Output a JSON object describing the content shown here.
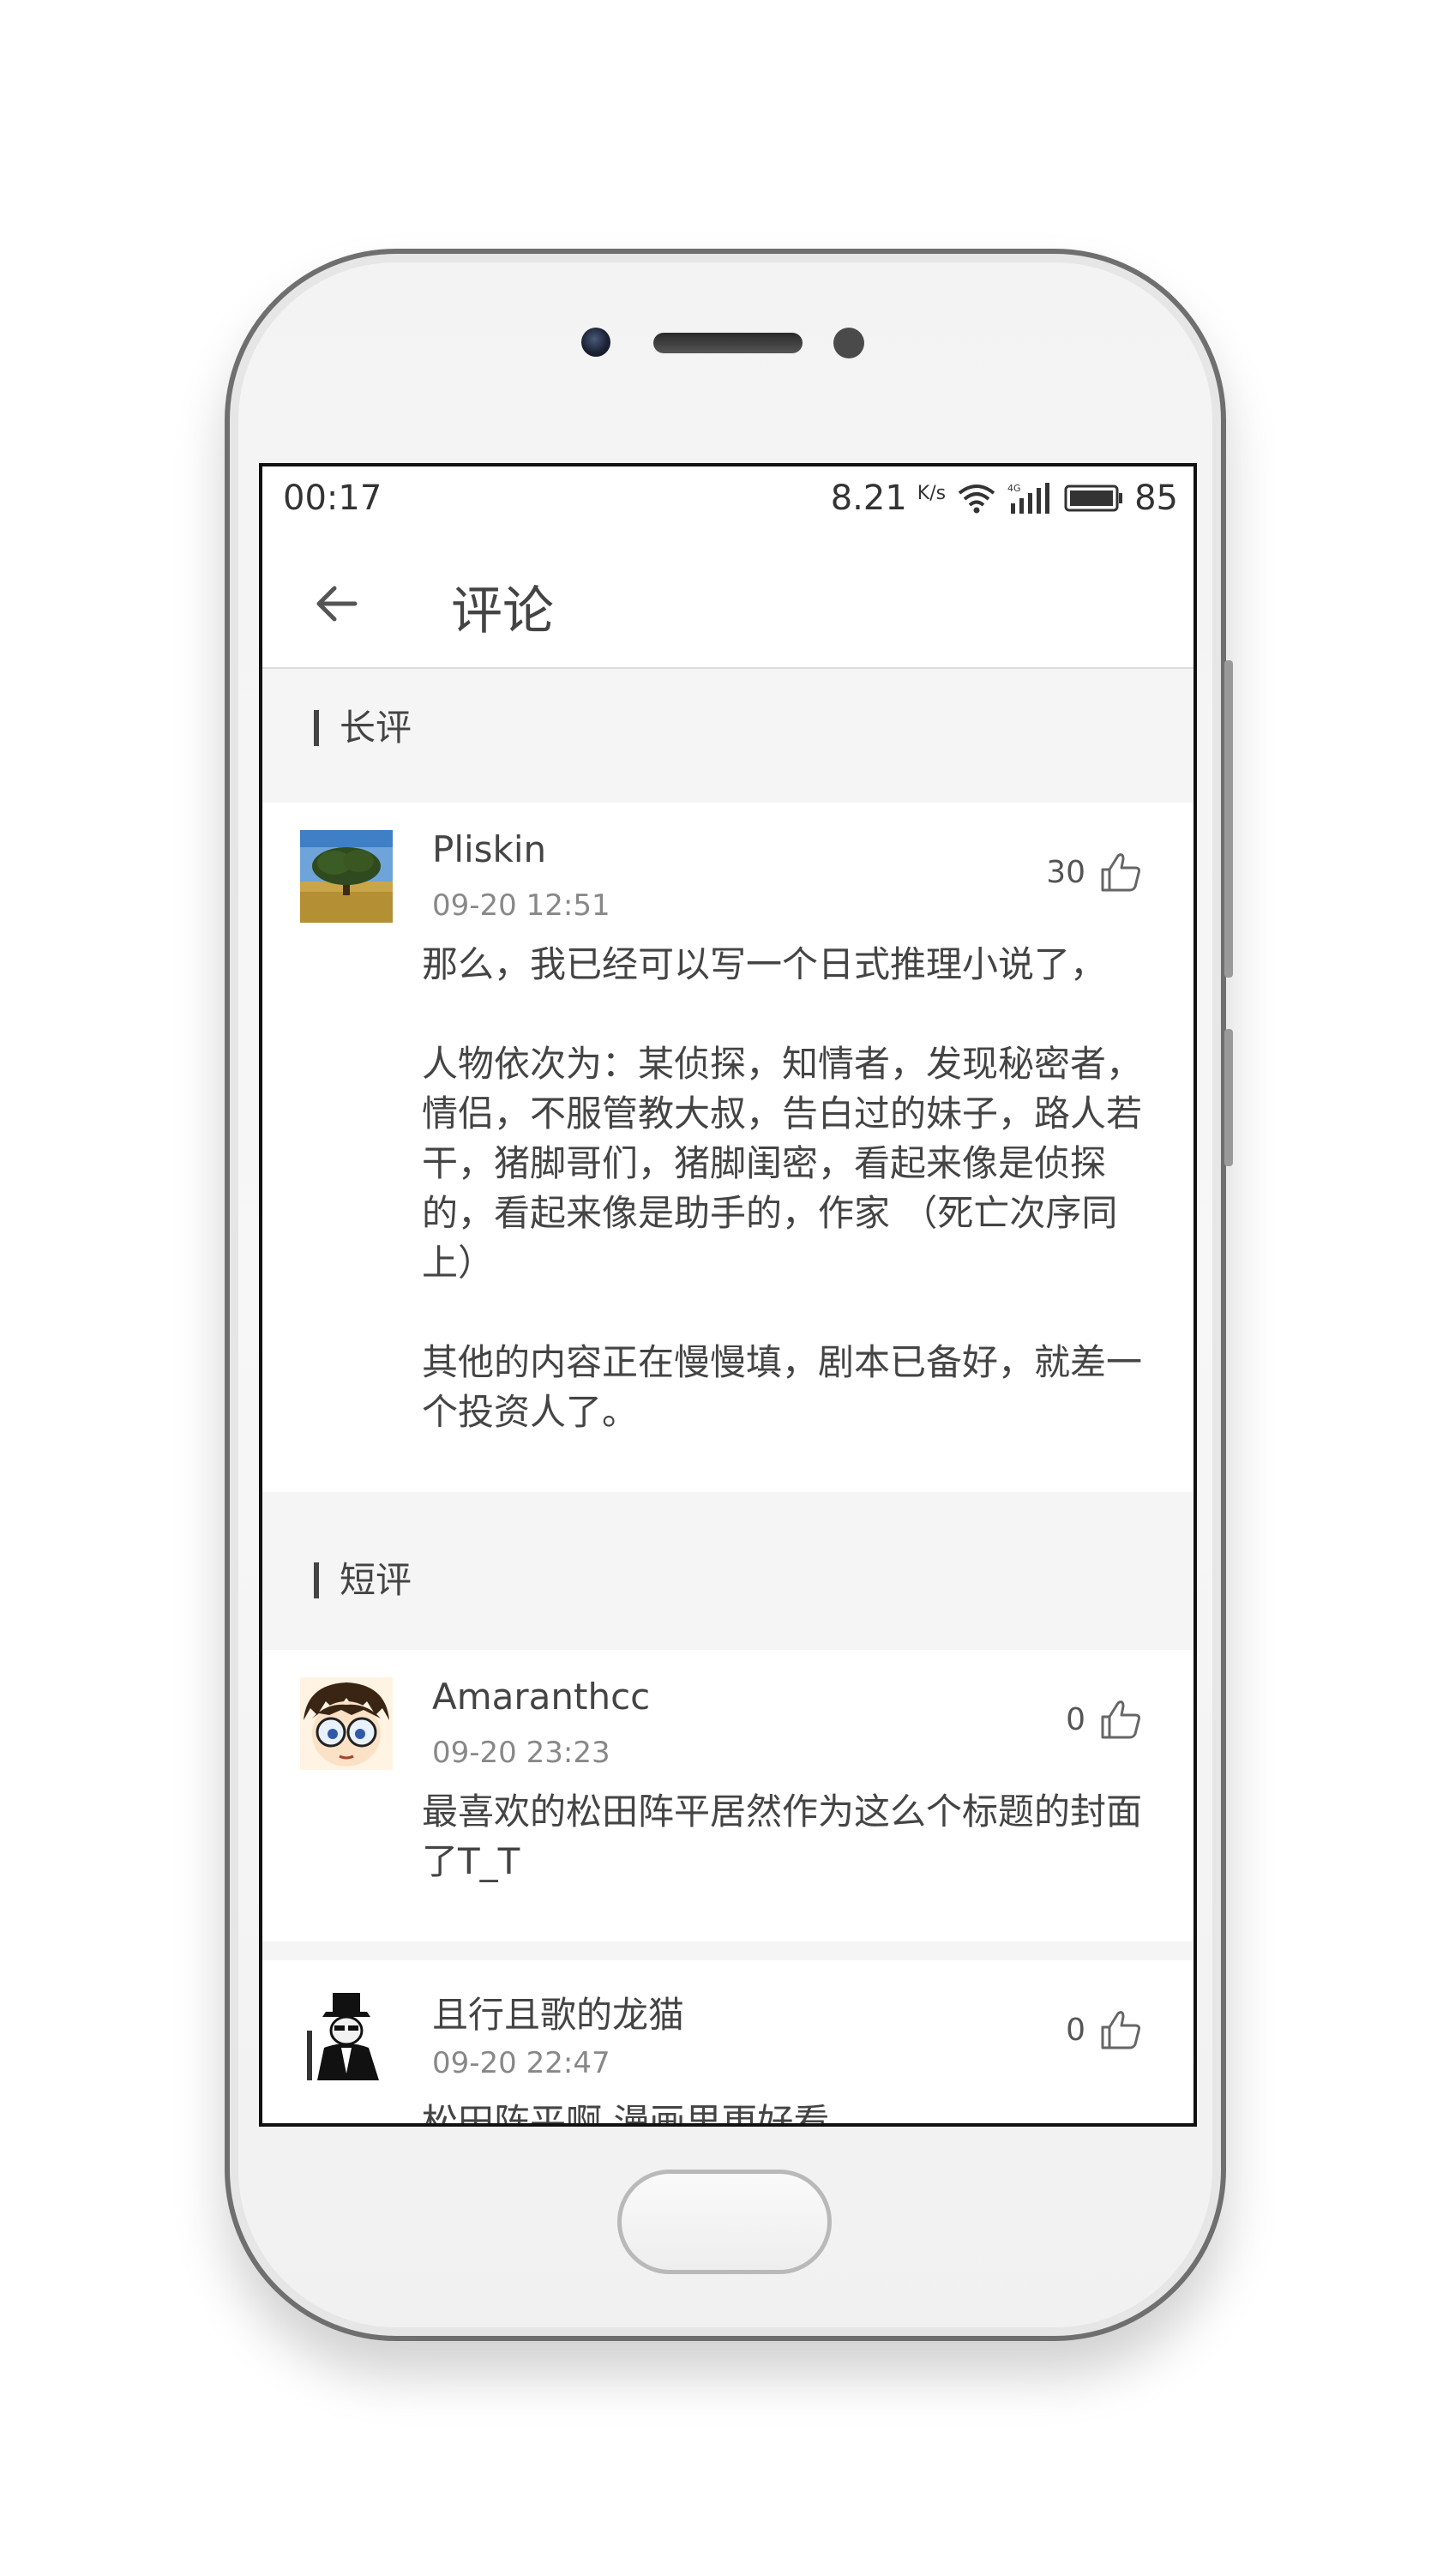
{
  "status_bar": {
    "time": "00:17",
    "net_speed": "8.21",
    "net_unit": "K/s",
    "battery": "85"
  },
  "toolbar": {
    "title": "评论"
  },
  "sections": {
    "long_reviews": {
      "title": "长评"
    },
    "short_reviews": {
      "title": "短评"
    }
  },
  "comments": [
    {
      "author": "Pliskin",
      "time": "09-20 12:51",
      "likes": "30",
      "body": "那么，我已经可以写一个日式推理小说了，\n\n人物依次为：某侦探，知情者，发现秘密者，情侣，不服管教大叔，告白过的妹子，路人若干，猪脚哥们，猪脚闺密，看起来像是侦探的，看起来像是助手的，作家 （死亡次序同上）\n\n其他的内容正在慢慢填，剧本已备好，就差一个投资人了。"
    },
    {
      "author": "Amaranthcc",
      "time": "09-20 23:23",
      "likes": "0",
      "body": "最喜欢的松田阵平居然作为这么个标题的封面了T_T"
    },
    {
      "author": "且行且歌的龙猫",
      "time": "09-20 22:47",
      "likes": "0",
      "body": "松田阵平啊 漫画里更好看"
    }
  ],
  "icons": {
    "back": "arrow-left-icon",
    "like": "thumbs-up-icon",
    "wifi": "wifi-icon",
    "signal": "signal-4g-icon",
    "battery": "battery-icon"
  },
  "colors": {
    "text": "#444444",
    "muted": "#888888",
    "background": "#f5f5f5"
  }
}
